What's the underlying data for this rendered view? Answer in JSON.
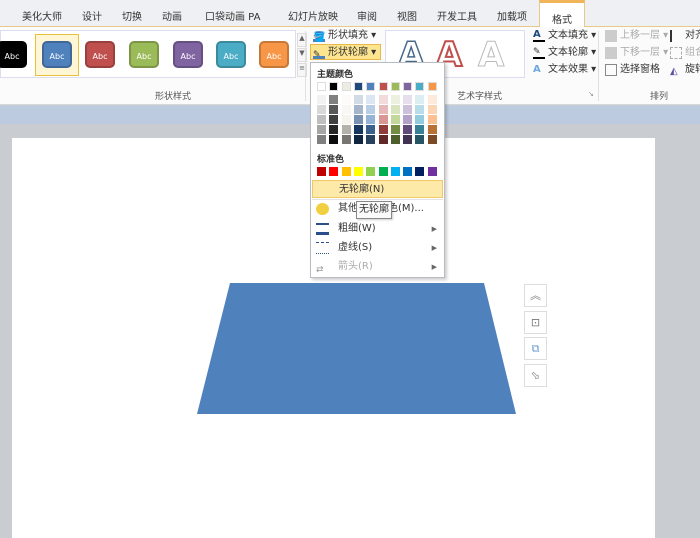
{
  "tabs": [
    "美化大师",
    "设计",
    "切换",
    "动画",
    "口袋动画 PA",
    "幻灯片放映",
    "审阅",
    "视图",
    "开发工具",
    "加载项",
    "格式"
  ],
  "shape_styles": {
    "label": "形状样式",
    "swatch_text": "Abc",
    "colors": [
      "#000000",
      "#4f81bd",
      "#c0504d",
      "#9bbb59",
      "#8064a2",
      "#4bacc6",
      "#f79646"
    ]
  },
  "shape_fill": "形状填充",
  "shape_outline": "形状轮廓",
  "wordart": {
    "label": "艺术字样式",
    "text_fill": "文本填充",
    "text_outline": "文本轮廓",
    "text_effects": "文本效果",
    "letter": "A"
  },
  "arrange": {
    "label": "排列",
    "bring_forward": "上移一层",
    "send_backward": "下移一层",
    "selection_pane": "选择窗格",
    "align": "对齐",
    "group": "组合",
    "rotate": "旋转"
  },
  "menu": {
    "theme_colors_label": "主题颜色",
    "standard_colors_label": "标准色",
    "theme_colors": [
      "#ffffff",
      "#000000",
      "#eeece1",
      "#1f497d",
      "#4f81bd",
      "#c0504d",
      "#9bbb59",
      "#8064a2",
      "#4bacc6",
      "#f79646"
    ],
    "standard_colors": [
      "#c00000",
      "#ff0000",
      "#ffc000",
      "#ffff00",
      "#92d050",
      "#00b050",
      "#00b0f0",
      "#0070c0",
      "#002060",
      "#7030a0"
    ],
    "no_outline": "无轮廓(N)",
    "more_colors": "其他轮廓颜色(M)...",
    "weight": "粗细(W)",
    "dashes": "虚线(S)",
    "arrows": "箭头(R)"
  },
  "tooltip": "无轮廓",
  "shape_color": "#4f81bd"
}
